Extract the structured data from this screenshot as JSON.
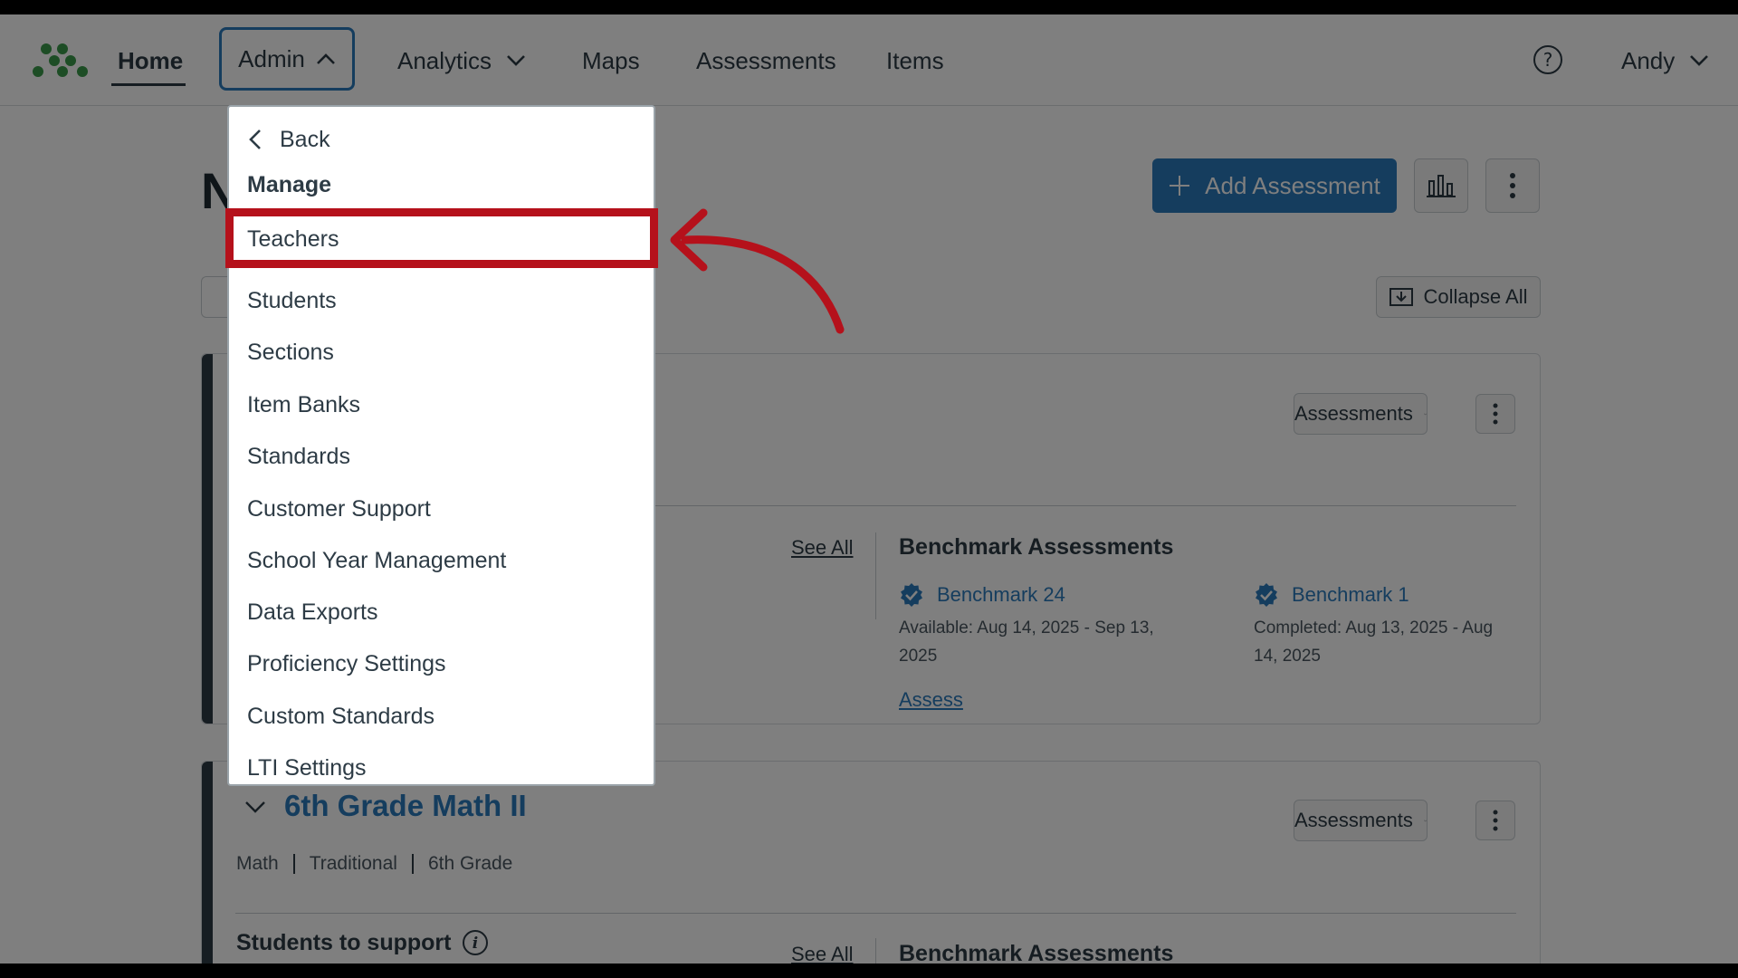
{
  "nav": {
    "home": "Home",
    "admin": "Admin",
    "analytics": "Analytics",
    "maps": "Maps",
    "assessments": "Assessments",
    "items": "Items",
    "user": "Andy"
  },
  "page": {
    "title_visible": "N",
    "add_assessment": "Add Assessment",
    "collapse_all": "Collapse All"
  },
  "cards": [
    {
      "assessments_btn": "Assessments",
      "see_all": "See All",
      "benchmark_title": "Benchmark Assessments",
      "benchmarks": [
        {
          "name": "Benchmark 24",
          "desc": "Available: Aug 14, 2025 - Sep 13, 2025"
        },
        {
          "name": "Benchmark 1",
          "desc": "Completed: Aug 13, 2025 - Aug 14, 2025"
        }
      ],
      "assess_link": "Assess"
    },
    {
      "title": "6th Grade Math II",
      "assessments_btn": "Assessments",
      "meta": [
        "Math",
        "Traditional",
        "6th Grade"
      ],
      "support_title": "Students to support",
      "see_all": "See All",
      "benchmark_title": "Benchmark Assessments"
    }
  ],
  "dropdown": {
    "back": "Back",
    "section": "Manage",
    "items": [
      "Teachers",
      "Students",
      "Sections",
      "Item Banks",
      "Standards",
      "Customer Support",
      "School Year Management",
      "Data Exports",
      "Proficiency Settings",
      "Custom Standards",
      "LTI Settings"
    ]
  },
  "colors": {
    "accent_blue": "#2b7abc",
    "highlight_red": "#b5111b",
    "logo_green": "#3a9a4a",
    "text": "#2d3b45"
  }
}
